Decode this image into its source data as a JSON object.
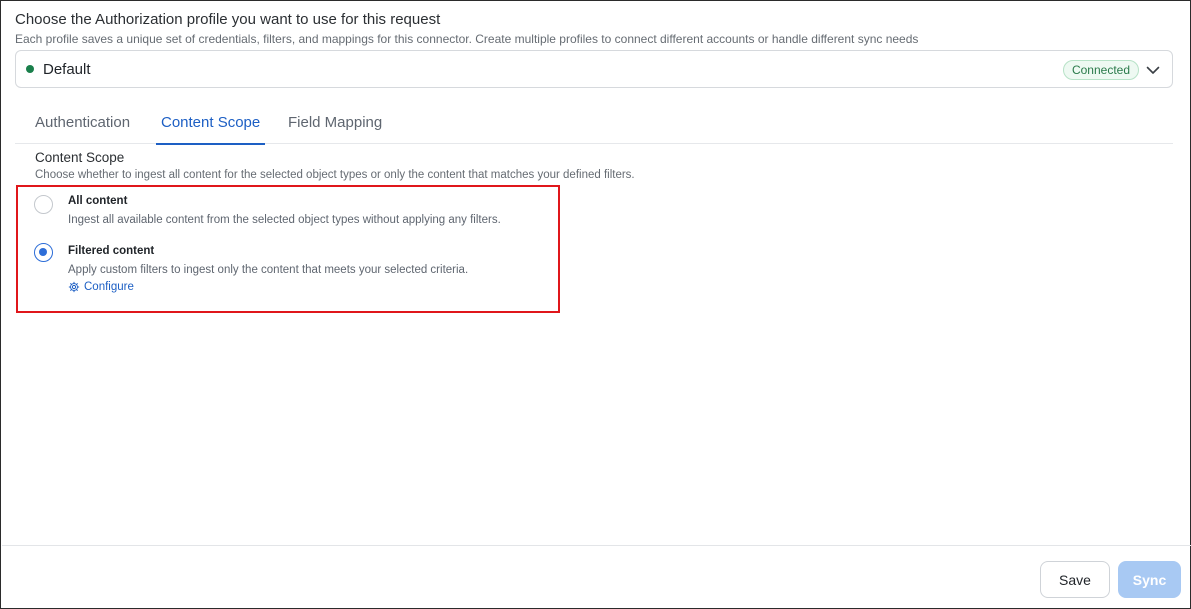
{
  "header": {
    "title": "Choose the Authorization profile you want to use for this request",
    "subtitle": "Each profile saves a unique set of credentials, filters, and mappings for this connector. Create multiple profiles to connect different accounts or handle different sync needs"
  },
  "profile": {
    "name": "Default",
    "status": "Connected",
    "status_color": "#1a7f4b"
  },
  "tabs": [
    {
      "label": "Authentication",
      "active": false
    },
    {
      "label": "Content Scope",
      "active": true
    },
    {
      "label": "Field Mapping",
      "active": false
    }
  ],
  "content_scope": {
    "title": "Content Scope",
    "description": "Choose whether to ingest all content for the selected object types or only the content that matches your defined filters.",
    "options": [
      {
        "title": "All content",
        "description": "Ingest all available content from the selected object types without applying any filters.",
        "selected": false
      },
      {
        "title": "Filtered content",
        "description": "Apply custom filters to ingest only the content that meets your selected criteria.",
        "selected": true
      }
    ],
    "configure_label": "Configure",
    "configure_icon": "gear-icon"
  },
  "footer": {
    "save_label": "Save",
    "sync_label": "Sync"
  },
  "colors": {
    "accent": "#1d5fc4",
    "highlight_border": "#e0161b",
    "sync_disabled": "#a8c9f3"
  }
}
